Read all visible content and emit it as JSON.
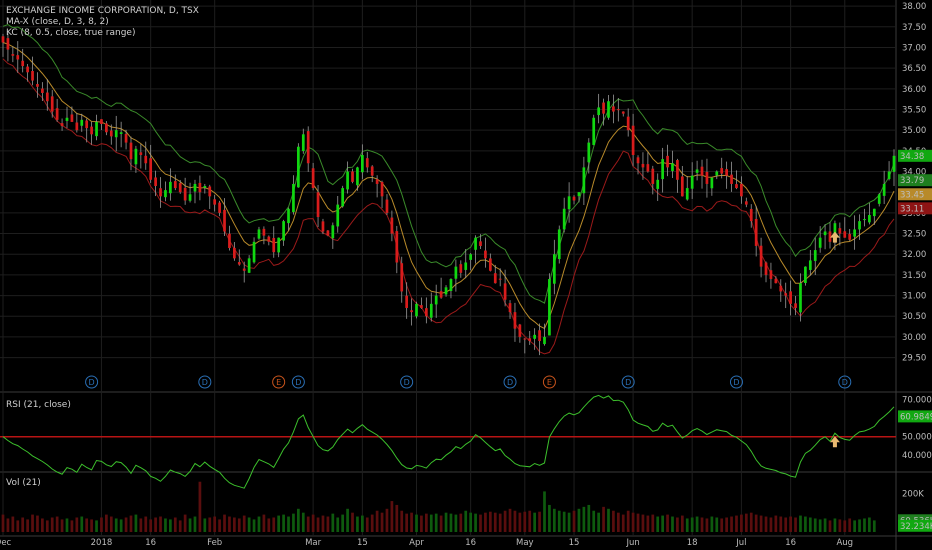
{
  "header": {
    "title": "EXCHANGE INCOME CORPORATION, D, TSX",
    "ma_label": "MA-X (close, D, 3, 8, 2)",
    "kc_label": "KC (8, 0.5, close, true range)",
    "rsi_label": "RSI (21, close)",
    "vol_label": "Vol (21)"
  },
  "colors": {
    "bull": "#11d811",
    "bear": "#d91c1c",
    "rsi_line": "#3cbf2c",
    "rsi_level": "#b81414",
    "kc_upper": "#3a8a2a",
    "kc_mid": "#b88a2a",
    "kc_lower": "#9a1a1a",
    "event_div": "#2a6fb5",
    "event_earn": "#c8541c",
    "arrow": "#e8b870",
    "grid": "#1e1e1e",
    "divider": "#3a3a3a"
  },
  "price_axis": {
    "ticks": [
      "38.00",
      "37.50",
      "37.00",
      "36.50",
      "36.00",
      "35.50",
      "35.00",
      "34.50",
      "34.00",
      "33.50",
      "33.00",
      "32.50",
      "32.00",
      "31.50",
      "31.00",
      "30.50",
      "30.00",
      "29.50"
    ],
    "badges": [
      {
        "text": "34.38",
        "value": 34.38,
        "color": "#11a811"
      },
      {
        "text": "33.79",
        "value": 33.79,
        "color": "#1f7f1f"
      },
      {
        "text": "33.45",
        "value": 33.45,
        "color": "#b88a2a"
      },
      {
        "text": "33.11",
        "value": 33.11,
        "color": "#8e1414"
      }
    ]
  },
  "rsi_axis": {
    "ticks": [
      "70.0000",
      "50.0000",
      "40.0000"
    ],
    "badge": {
      "text": "60.9849",
      "value": 60.98
    }
  },
  "vol_axis": {
    "ticks": [
      "200K"
    ],
    "badges": [
      {
        "text": "60.536K",
        "value": 60536,
        "color": "#1f7f1f"
      },
      {
        "text": "32.234K",
        "value": 32234,
        "color": "#11a811"
      }
    ]
  },
  "x_axis": {
    "labels": [
      {
        "text": "Dec",
        "index": 0
      },
      {
        "text": "2018",
        "index": 20
      },
      {
        "text": "16",
        "index": 30
      },
      {
        "text": "Feb",
        "index": 43
      },
      {
        "text": "Mar",
        "index": 63
      },
      {
        "text": "15",
        "index": 73
      },
      {
        "text": "Apr",
        "index": 84
      },
      {
        "text": "16",
        "index": 95
      },
      {
        "text": "May",
        "index": 106
      },
      {
        "text": "15",
        "index": 116
      },
      {
        "text": "Jun",
        "index": 128
      },
      {
        "text": "18",
        "index": 140
      },
      {
        "text": "Jul",
        "index": 150
      },
      {
        "text": "16",
        "index": 160
      },
      {
        "text": "Aug",
        "index": 171
      }
    ]
  },
  "events": [
    {
      "type": "D",
      "label": "D",
      "index": 18
    },
    {
      "type": "D",
      "label": "D",
      "index": 41
    },
    {
      "type": "E",
      "label": "E",
      "index": 56
    },
    {
      "type": "D",
      "label": "D",
      "index": 60
    },
    {
      "type": "D",
      "label": "D",
      "index": 82
    },
    {
      "type": "D",
      "label": "D",
      "index": 103
    },
    {
      "type": "E",
      "label": "E",
      "index": 111
    },
    {
      "type": "D",
      "label": "D",
      "index": 127
    },
    {
      "type": "D",
      "label": "D",
      "index": 149
    },
    {
      "type": "D",
      "label": "D",
      "index": 171
    }
  ],
  "arrows": [
    {
      "pane": "price",
      "index": 169,
      "value": 32.4
    },
    {
      "pane": "rsi",
      "index": 169,
      "value": 47
    }
  ],
  "chart_data": {
    "type": "candlestick",
    "title": "EXCHANGE INCOME CORPORATION, D, TSX",
    "price_ylim": [
      29.2,
      38.1
    ],
    "rsi_ylim": [
      32,
      72
    ],
    "rsi_level": 50,
    "vol_ylim": [
      0,
      300000
    ],
    "close": [
      37.12,
      36.95,
      36.8,
      36.71,
      36.55,
      36.4,
      36.2,
      36.05,
      35.9,
      35.7,
      35.45,
      35.25,
      35.1,
      35.3,
      35.2,
      35.0,
      35.25,
      35.05,
      34.9,
      35.2,
      35.15,
      34.95,
      34.85,
      35.0,
      34.95,
      34.7,
      34.3,
      34.55,
      34.4,
      34.2,
      33.8,
      33.65,
      33.4,
      33.55,
      33.75,
      33.6,
      33.5,
      33.3,
      33.45,
      33.7,
      33.5,
      33.65,
      33.4,
      33.2,
      33.0,
      32.55,
      32.15,
      31.9,
      31.75,
      31.6,
      31.9,
      32.3,
      32.6,
      32.45,
      32.3,
      32.05,
      32.4,
      32.8,
      33.1,
      33.7,
      34.6,
      34.9,
      34.2,
      33.6,
      32.9,
      32.55,
      32.45,
      32.7,
      33.2,
      33.6,
      34.0,
      33.75,
      34.1,
      34.4,
      34.1,
      33.9,
      33.7,
      33.4,
      33.0,
      32.5,
      31.8,
      31.1,
      30.7,
      30.6,
      30.8,
      30.7,
      30.5,
      30.8,
      31.0,
      30.95,
      31.2,
      31.4,
      31.7,
      31.55,
      31.8,
      32.0,
      32.4,
      32.2,
      31.9,
      31.6,
      31.3,
      31.4,
      30.9,
      30.6,
      30.2,
      30.0,
      29.95,
      29.9,
      30.05,
      29.9,
      30.0,
      31.4,
      32.0,
      32.6,
      33.1,
      33.4,
      33.3,
      33.5,
      34.1,
      34.7,
      35.3,
      35.55,
      35.4,
      35.7,
      35.45,
      35.5,
      35.4,
      35.0,
      34.4,
      34.2,
      34.1,
      34.0,
      33.7,
      33.8,
      34.3,
      34.1,
      34.2,
      33.8,
      33.4,
      33.6,
      33.9,
      34.05,
      33.9,
      33.7,
      33.85,
      34.0,
      33.95,
      33.9,
      33.7,
      33.6,
      33.4,
      33.2,
      32.8,
      32.2,
      31.7,
      31.5,
      31.4,
      31.3,
      31.1,
      31.0,
      30.8,
      30.7,
      31.3,
      31.7,
      31.85,
      32.1,
      32.4,
      32.55,
      32.3,
      32.75,
      32.5,
      32.4,
      32.35,
      32.6,
      32.8,
      32.85,
      32.95,
      33.1,
      33.45,
      33.7,
      34.0,
      34.38
    ],
    "volume": [
      90000,
      70000,
      80000,
      60000,
      75000,
      65000,
      90000,
      85000,
      70000,
      60000,
      75000,
      80000,
      65000,
      70000,
      60000,
      75000,
      80000,
      70000,
      65000,
      60000,
      75000,
      90000,
      80000,
      70000,
      65000,
      75000,
      85000,
      90000,
      70000,
      80000,
      65000,
      75000,
      80000,
      70000,
      65000,
      75000,
      60000,
      90000,
      70000,
      80000,
      260000,
      70000,
      75000,
      80000,
      65000,
      90000,
      80000,
      75000,
      70000,
      85000,
      75000,
      65000,
      80000,
      90000,
      70000,
      75000,
      85000,
      90000,
      80000,
      95000,
      120000,
      100000,
      80000,
      90000,
      75000,
      85000,
      80000,
      95000,
      75000,
      90000,
      120000,
      100000,
      80000,
      85000,
      75000,
      90000,
      110000,
      100000,
      120000,
      160000,
      140000,
      110000,
      95000,
      100000,
      90000,
      85000,
      95000,
      90000,
      95000,
      85000,
      100000,
      95000,
      90000,
      95000,
      110000,
      100000,
      95000,
      90000,
      100000,
      105000,
      100000,
      95000,
      110000,
      120000,
      110000,
      100000,
      105000,
      110000,
      100000,
      105000,
      210000,
      140000,
      120000,
      110000,
      105000,
      100000,
      110000,
      120000,
      130000,
      140000,
      110000,
      100000,
      130000,
      120000,
      110000,
      100000,
      90000,
      110000,
      100000,
      95000,
      90000,
      85000,
      90000,
      80000,
      85000,
      90000,
      80000,
      75000,
      85000,
      70000,
      75000,
      80000,
      75000,
      70000,
      80000,
      75000,
      70000,
      75000,
      80000,
      85000,
      90000,
      95000,
      100000,
      90000,
      85000,
      80000,
      75000,
      85000,
      80000,
      75000,
      80000,
      75000,
      85000,
      80000,
      75000,
      70000,
      65000,
      70000,
      60000,
      70000,
      65000,
      60000,
      70000,
      60000,
      65000,
      70000,
      75000,
      60000
    ]
  }
}
